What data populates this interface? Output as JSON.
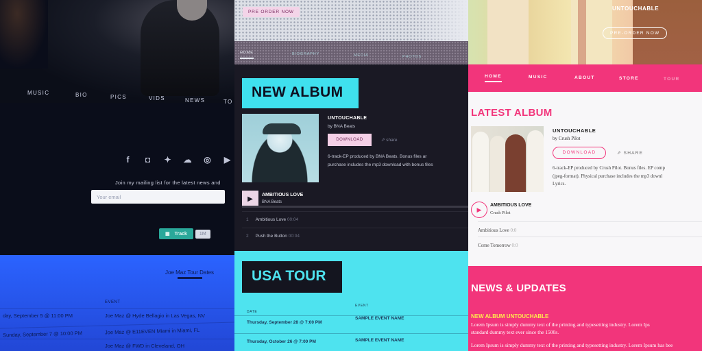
{
  "colors": {
    "left_accent": "#2b63ff",
    "mid_accent": "#3fe0ee",
    "mid_pink": "#f4cfe6",
    "right_accent": "#f2357b",
    "right_highlight": "#ffe94d"
  },
  "left": {
    "nav": [
      "MUSIC",
      "BIO",
      "PICS",
      "VIDS",
      "NEWS",
      "TO"
    ],
    "social_icons": [
      "facebook-icon",
      "instagram-icon",
      "twitter-icon",
      "soundcloud-icon",
      "globe-icon",
      "youtube-icon"
    ],
    "mailing_label": "Join my mailing list for the latest news and",
    "email_placeholder": "Your email",
    "track_label": "Track",
    "track_count": "1M",
    "tour_link": "Joe Maz Tour Dates",
    "event_header": "EVENT",
    "rows": [
      {
        "date": "day, September 5 @ 11:00 PM",
        "event": "Joe Maz @ Hyde Bellagio in Las Vegas, NV"
      },
      {
        "date": "Sunday, September 7 @ 10:00 PM",
        "event": "Joe Maz @ E11EVEN Miami in Miami, FL"
      },
      {
        "date": "",
        "event": "Joe Maz @ FWD in Cleveland, OH"
      }
    ]
  },
  "middle": {
    "preorder": "PRE ORDER NOW",
    "nav": [
      "HOME",
      "BIOGRAPHY",
      "MEDIA",
      "PHOTOS"
    ],
    "album_heading": "NEW ALBUM",
    "album_title": "UNTOUCHABLE",
    "album_by": "by BNA Beats",
    "download": "DOWNLOAD",
    "share": "share",
    "desc_lines": [
      "6-track-EP produced by BNA Beats. Bonus files ar",
      "purchase includes the mp3 download with bonus files"
    ],
    "song": "AMBITIOUS LOVE",
    "artist": "BNA Beats",
    "tracks": [
      {
        "num": "1",
        "name": "Ambitious Love",
        "time": "00:04"
      },
      {
        "num": "2",
        "name": "Push the Button",
        "time": "00:04"
      }
    ],
    "tour_heading": "USA TOUR",
    "th_date": "DATE",
    "th_event": "EVENT",
    "tour_rows": [
      {
        "date": "Thursday, September 28 @ 7:00 PM",
        "event": "SAMPLE EVENT NAME"
      },
      {
        "date": "Thursday, October 26 @ 7:00 PM",
        "event": "SAMPLE EVENT NAME"
      }
    ]
  },
  "right": {
    "photo_title": "UNTOUCHABLE",
    "preorder": "PRE-ORDER NOW",
    "nav": [
      "HOME",
      "MUSIC",
      "ABOUT",
      "STORE",
      "TOUR"
    ],
    "album_heading": "LATEST ALBUM",
    "album_title": "UNTOUCHABLE",
    "album_by": "by Crush Pilot",
    "download": "DOWNLOAD",
    "share": "SHARE",
    "desc_lines": [
      "6-track-EP produced by Crush Pilot. Bonus files. EP comp",
      "(jpeg-format). Physical purchase includes the mp3 downl",
      "Lyrics."
    ],
    "song": "AMBITIOUS LOVE",
    "artist": "Crush Pilot",
    "tracks": [
      {
        "name": "Ambitious Love",
        "time": "0:0"
      },
      {
        "name": "Come Tomorrow",
        "time": "0:0"
      }
    ],
    "news_heading": "NEWS & UPDATES",
    "news_sub": "NEW ALBUM UNTOUCHABLE",
    "news_lines": [
      "Lorem Ipsum is simply dummy text of the printing and typesetting industry. Lorem Ips",
      "standard dummy text ever since the 1500s.",
      "Lorem Ipsum is simply dummy text of the printing and typesetting industry. Lorem Ipsum has bee"
    ]
  }
}
